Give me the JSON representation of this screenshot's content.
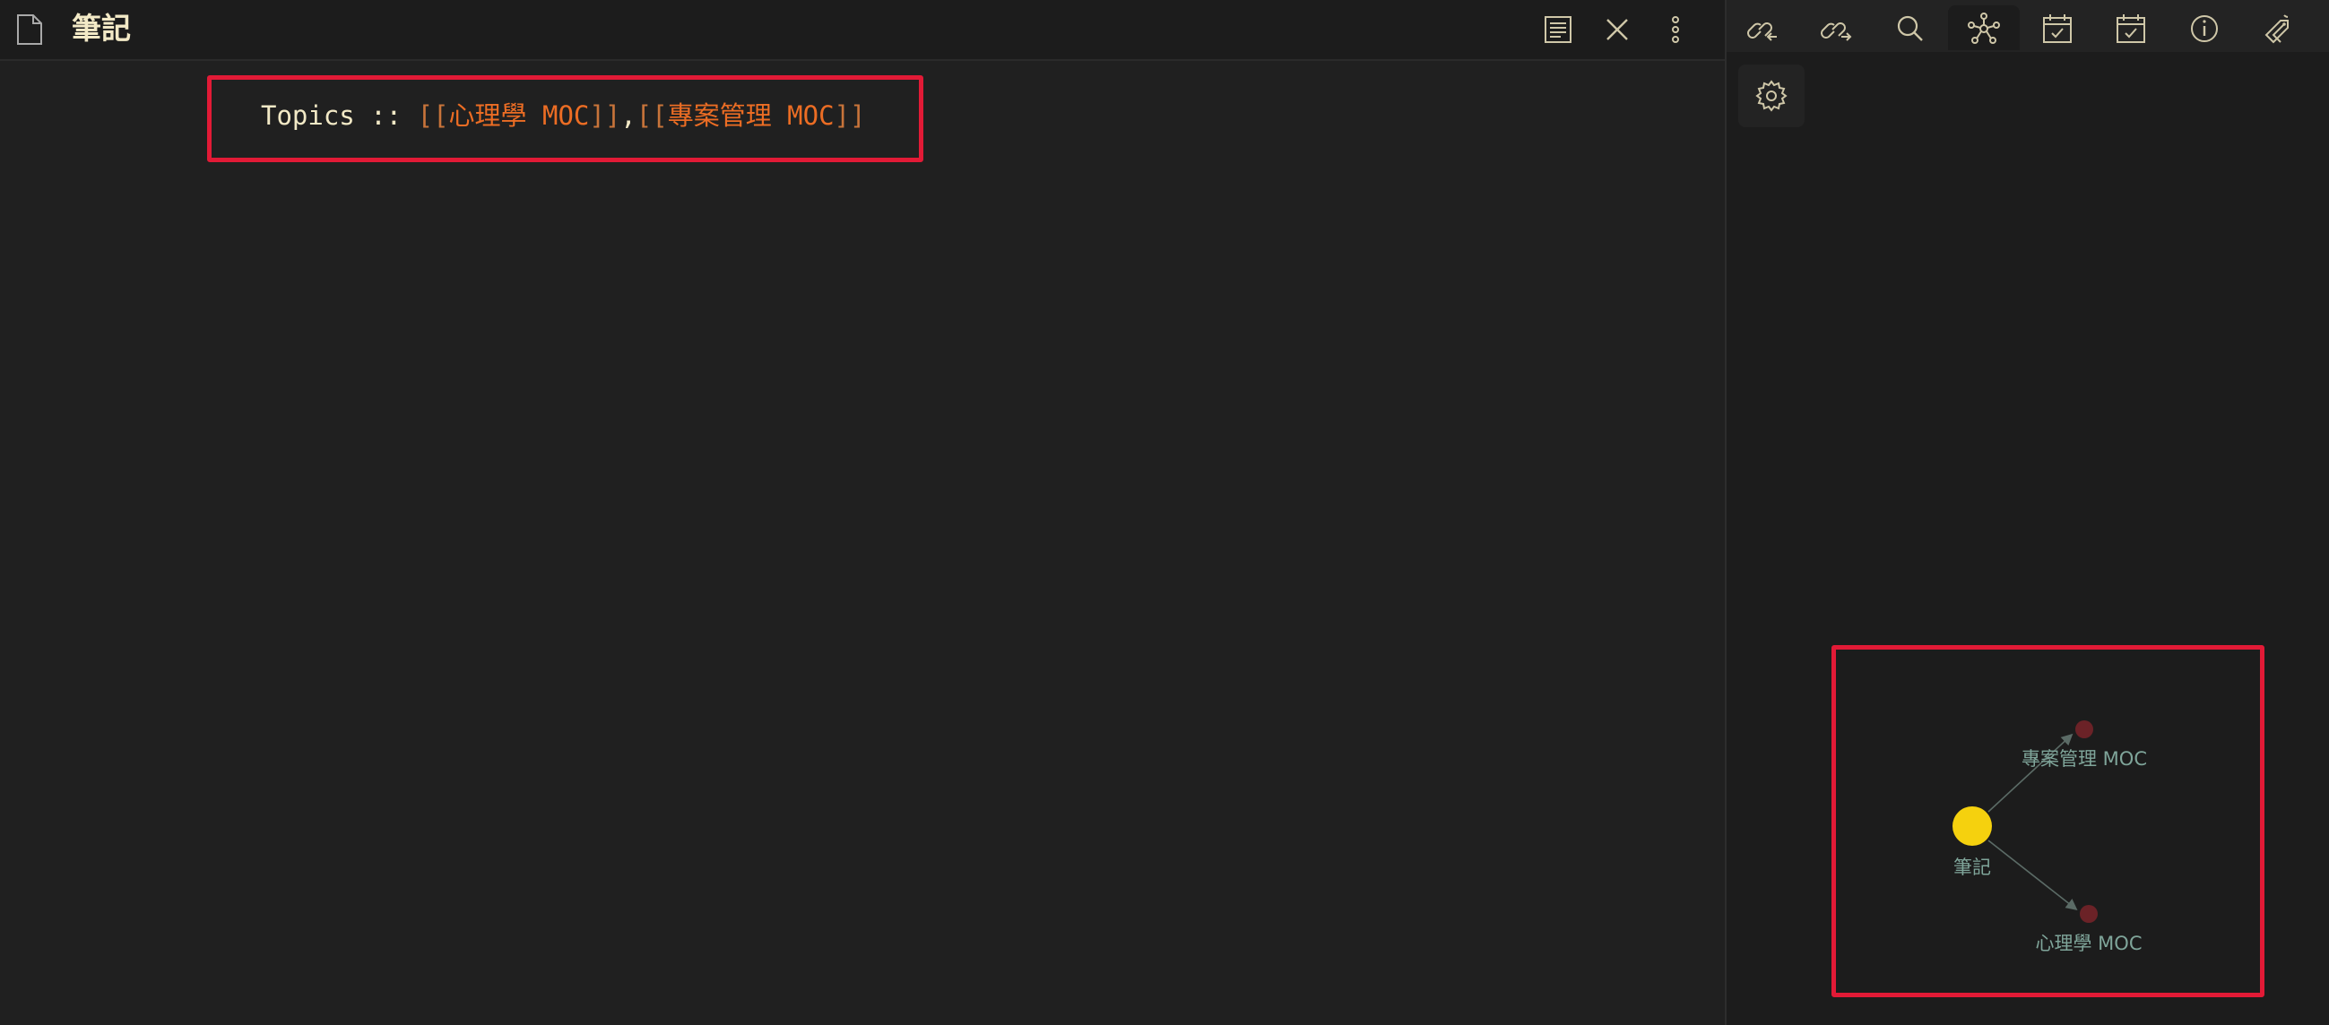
{
  "header": {
    "title": "筆記",
    "reading_view_icon": "reading-view-icon",
    "close_icon": "close-icon",
    "more_icon": "more-options-icon"
  },
  "editor": {
    "property_key": "Topics ::",
    "open_brackets_1": "[[",
    "link_1": "心理學 MOC",
    "close_brackets_1": "]]",
    "separator": ",",
    "open_brackets_2": "[[",
    "link_2": "專案管理 MOC",
    "close_brackets_2": "]]"
  },
  "sidebar": {
    "tabs": [
      {
        "icon": "backlinks-icon",
        "active": false
      },
      {
        "icon": "outgoing-links-icon",
        "active": false
      },
      {
        "icon": "search-icon",
        "active": false
      },
      {
        "icon": "local-graph-icon",
        "active": true
      },
      {
        "icon": "calendar-check-icon",
        "active": false
      },
      {
        "icon": "calendar-check-icon-2",
        "active": false
      },
      {
        "icon": "info-icon",
        "active": false
      },
      {
        "icon": "tag-pane-icon",
        "active": false
      }
    ],
    "settings_icon": "gear-icon"
  },
  "graph": {
    "center_node": "筆記",
    "linked_nodes": [
      "專案管理 MOC",
      "心理學 MOC"
    ],
    "center_color": "#f5d10e",
    "linked_color": "#6b2227",
    "label_color": "#7fa59a"
  },
  "colors": {
    "highlight_box": "#e21a36",
    "link_text": "#ec6d24",
    "title_text": "#f2e9c6"
  }
}
